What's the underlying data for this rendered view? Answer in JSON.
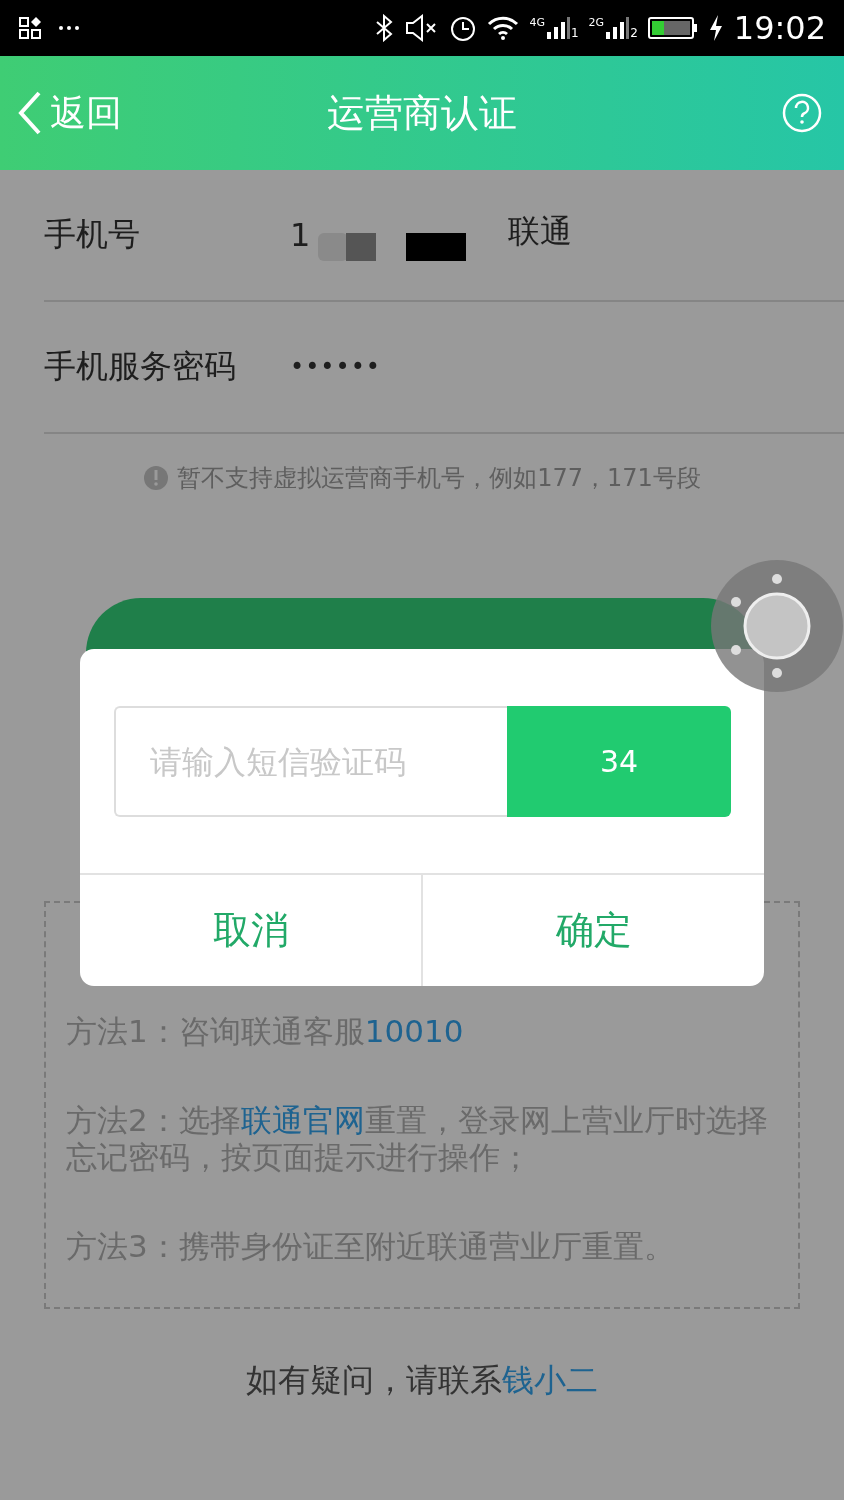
{
  "status_bar": {
    "time": "19:02",
    "networks": [
      {
        "generation": "4G",
        "sim": "1"
      },
      {
        "generation": "2G",
        "sim": "2"
      }
    ]
  },
  "header": {
    "back": "返回",
    "title": "运营商认证"
  },
  "form": {
    "rows": [
      {
        "kind": "phone",
        "label": "手机号",
        "value": "1",
        "carrier": "联通"
      },
      {
        "kind": "password",
        "label": "手机服务密码",
        "value": "••••••"
      }
    ],
    "notice": "暂不支持虚拟运营商手机号，例如177，171号段"
  },
  "help": {
    "methods": [
      [
        {
          "kind": "text",
          "text": "方法1：咨询联通客服"
        },
        {
          "kind": "link",
          "text": "10010"
        }
      ],
      [
        {
          "kind": "text",
          "text": "方法2：选择"
        },
        {
          "kind": "link",
          "text": "联通官网"
        },
        {
          "kind": "text",
          "text": "重置，登录网上营业厅时选择忘记密码，按页面提示进行操作；"
        }
      ],
      [
        {
          "kind": "text",
          "text": "方法3：携带身份证至附近联通营业厅重置。"
        }
      ]
    ]
  },
  "footer": [
    {
      "kind": "text",
      "text": "如有疑问，请联系"
    },
    {
      "kind": "link",
      "text": "钱小二"
    }
  ],
  "dialog": {
    "placeholder": "请输入短信验证码",
    "countdown": "34",
    "buttons": [
      "取消",
      "确定"
    ]
  }
}
